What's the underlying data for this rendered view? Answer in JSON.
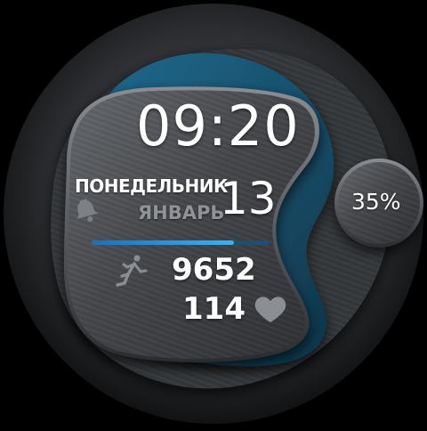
{
  "watchface": {
    "time": "09:20",
    "weekday": "ПОНЕДЕЛЬНИК",
    "month": "ЯНВАРЬ",
    "day": "13",
    "steps": "9652",
    "heart_rate": "114",
    "battery": "35%",
    "icons": {
      "alarm": "bell-icon",
      "activity": "running-person-icon",
      "heart": "heart-icon"
    },
    "colors": {
      "accent_teal": "#1b5a78",
      "progress_bar": "#2f9be0",
      "metal_dark": "#3b3d40",
      "metal_light": "#5a5d60",
      "muted_text": "#8f9397",
      "background": "#000000"
    },
    "steps_progress": 0.8
  }
}
